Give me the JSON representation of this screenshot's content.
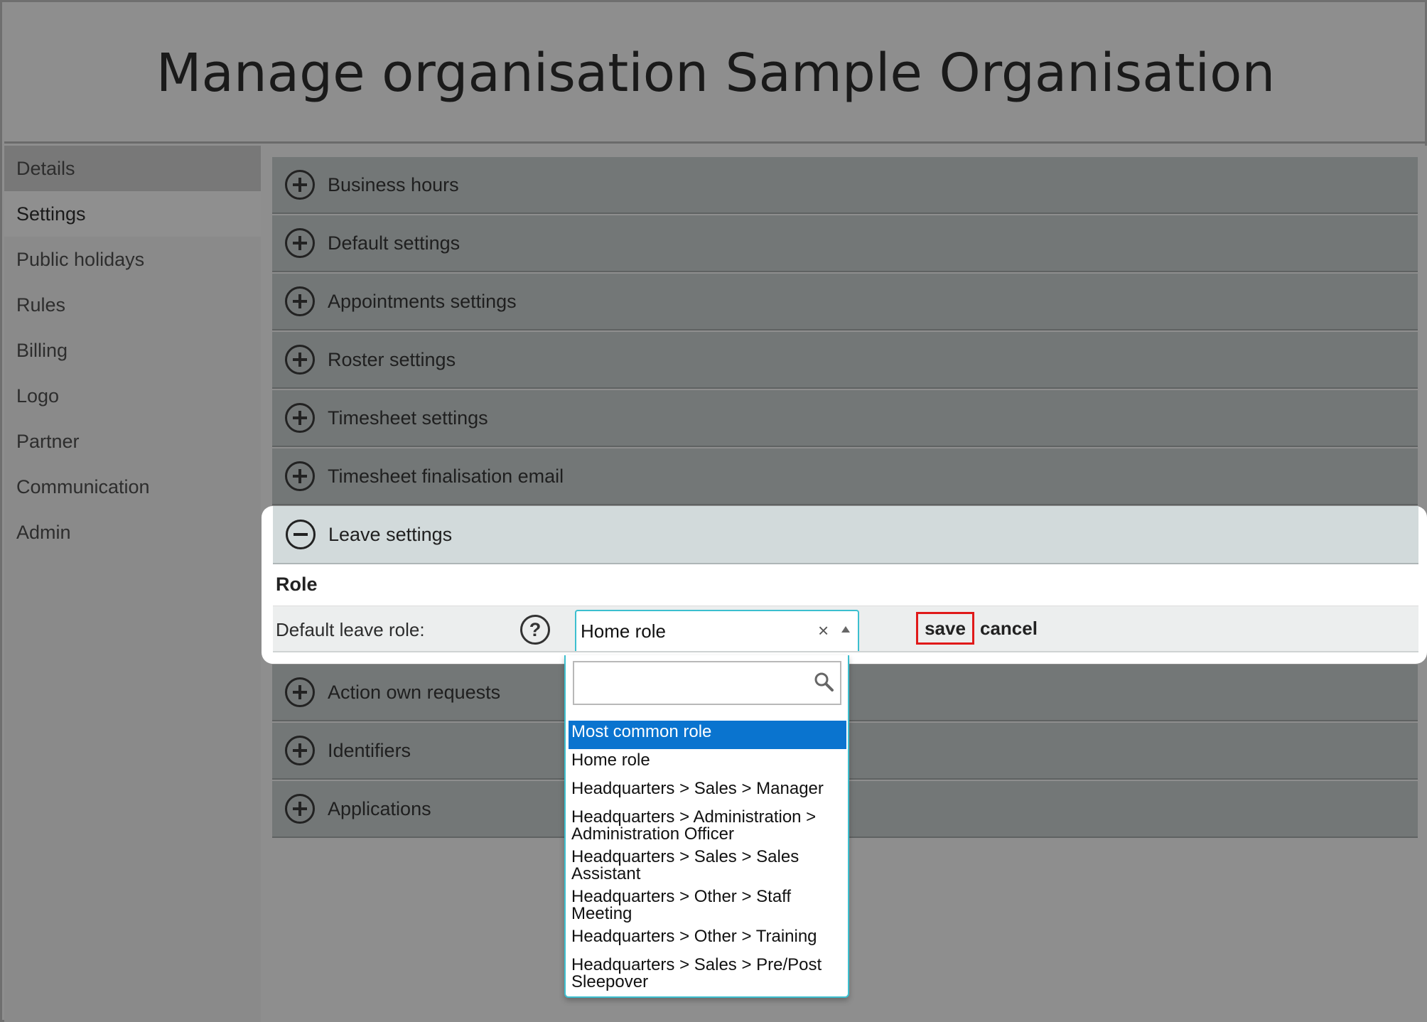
{
  "header": {
    "title": "Manage organisation Sample Organisation"
  },
  "sidebar": {
    "items": [
      {
        "label": "Details",
        "name": "sidebar-item-details",
        "state": "normal"
      },
      {
        "label": "Settings",
        "name": "sidebar-item-settings",
        "state": "active"
      },
      {
        "label": "Public holidays",
        "name": "sidebar-item-public-holidays",
        "state": "normal"
      },
      {
        "label": "Rules",
        "name": "sidebar-item-rules",
        "state": "normal"
      },
      {
        "label": "Billing",
        "name": "sidebar-item-billing",
        "state": "normal"
      },
      {
        "label": "Logo",
        "name": "sidebar-item-logo",
        "state": "normal"
      },
      {
        "label": "Partner",
        "name": "sidebar-item-partner",
        "state": "normal"
      },
      {
        "label": "Communication",
        "name": "sidebar-item-communication",
        "state": "normal"
      },
      {
        "label": "Admin",
        "name": "sidebar-item-admin",
        "state": "normal"
      }
    ]
  },
  "sections": {
    "business_hours": "Business hours",
    "default_settings": "Default settings",
    "appointments_settings": "Appointments settings",
    "roster_settings": "Roster settings",
    "timesheet_settings": "Timesheet settings",
    "timesheet_finalisation_email": "Timesheet finalisation email",
    "leave_settings": "Leave settings",
    "action_own_requests": "Action own requests",
    "identifiers": "Identifiers",
    "applications": "Applications"
  },
  "leave": {
    "role_heading": "Role",
    "default_leave_role_label": "Default leave role:",
    "help_glyph": "?",
    "selected_value": "Home role",
    "clear_glyph": "×",
    "save_label": "save",
    "cancel_label": "cancel",
    "search_value": "",
    "options": [
      "Most common role",
      "Home role",
      "Headquarters > Sales > Manager",
      "Headquarters > Administration > Administration Officer",
      "Headquarters > Sales > Sales Assistant",
      "Headquarters > Other > Staff Meeting",
      "Headquarters > Other > Training",
      "Headquarters > Sales > Pre/Post Sleepover"
    ],
    "highlighted_option_index": 0
  },
  "colors": {
    "highlight": "#0a74cf",
    "focus_border": "#3cbfcf",
    "save_outline": "#e01a1a"
  }
}
